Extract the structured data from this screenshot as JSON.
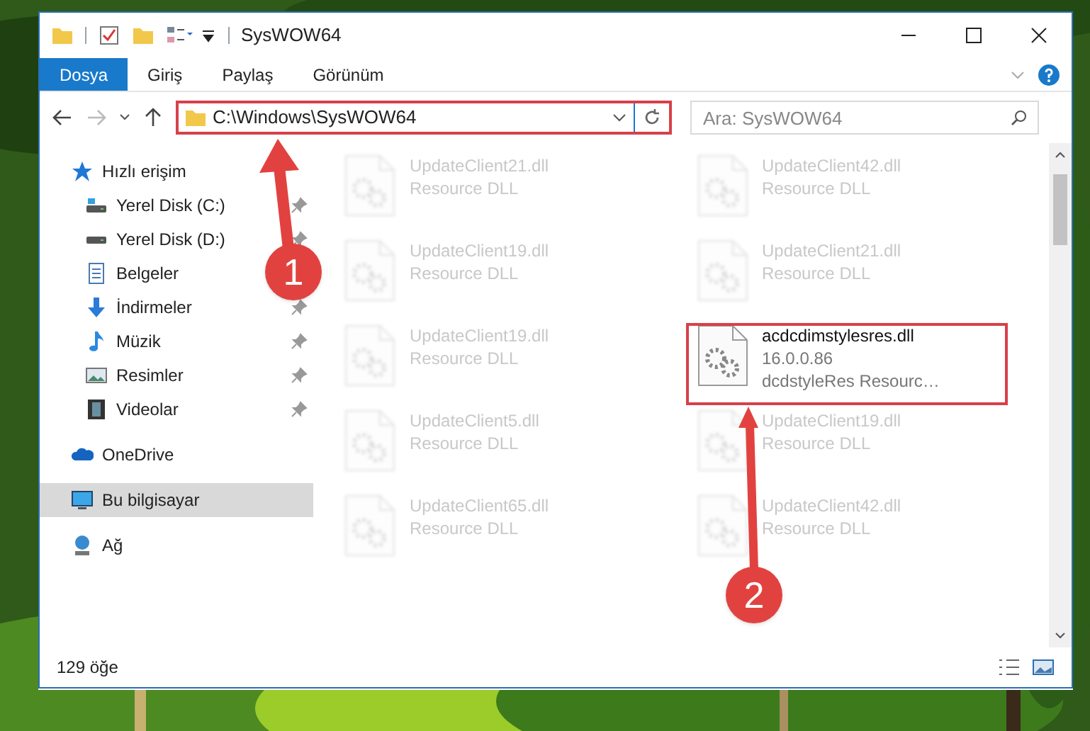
{
  "window": {
    "title": "SysWOW64"
  },
  "ribbon_tabs": [
    {
      "label": "Dosya",
      "kind": "file"
    },
    {
      "label": "Giriş",
      "kind": "tab"
    },
    {
      "label": "Paylaş",
      "kind": "tab"
    },
    {
      "label": "Görünüm",
      "kind": "tab"
    }
  ],
  "address": {
    "value": "C:\\Windows\\SysWOW64"
  },
  "search": {
    "placeholder": "Ara: SysWOW64"
  },
  "sidebar": {
    "items": [
      {
        "label": "Hızlı erişim",
        "kind": "star",
        "selected": false,
        "children": [
          {
            "label": "Yerel Disk (C:)",
            "kind": "drive-c",
            "pinned": true
          },
          {
            "label": "Yerel Disk (D:)",
            "kind": "drive",
            "pinned": true
          },
          {
            "label": "Belgeler",
            "kind": "docs",
            "pinned": false
          },
          {
            "label": "İndirmeler",
            "kind": "download",
            "pinned": true
          },
          {
            "label": "Müzik",
            "kind": "music",
            "pinned": true
          },
          {
            "label": "Resimler",
            "kind": "pictures",
            "pinned": true
          },
          {
            "label": "Videolar",
            "kind": "video",
            "pinned": true
          }
        ]
      },
      {
        "label": "OneDrive",
        "kind": "cloud",
        "selected": false
      },
      {
        "label": "Bu bilgisayar",
        "kind": "pc",
        "selected": true
      },
      {
        "label": "Ağ",
        "kind": "network",
        "selected": false
      }
    ]
  },
  "files": [
    {
      "name": "UpdateClient21.dll",
      "lines": [
        "Resource DLL"
      ],
      "dimmed": true
    },
    {
      "name": "UpdateClient42.dll",
      "lines": [
        "Resource DLL"
      ],
      "dimmed": true
    },
    {
      "name": "UpdateClient19.dll",
      "lines": [
        "Resource DLL"
      ],
      "dimmed": true
    },
    {
      "name": "UpdateClient21.dll",
      "lines": [
        "Resource DLL"
      ],
      "dimmed": true
    },
    {
      "name": "UpdateClient19.dll",
      "lines": [
        "Resource DLL"
      ],
      "dimmed": true
    },
    {
      "name": "acdcdimstylesres.dll",
      "lines": [
        "16.0.0.86",
        "dcdstyleRes Resourc…"
      ],
      "dimmed": false
    },
    {
      "name": "UpdateClient5.dll",
      "lines": [
        "Resource DLL"
      ],
      "dimmed": true
    },
    {
      "name": "UpdateClient19.dll",
      "lines": [
        "Resource DLL"
      ],
      "dimmed": true
    },
    {
      "name": "UpdateClient65.dll",
      "lines": [
        "Resource DLL"
      ],
      "dimmed": true
    },
    {
      "name": "UpdateClient42.dll",
      "lines": [
        "Resource DLL"
      ],
      "dimmed": true
    }
  ],
  "status_bar": {
    "count": "129 öğe"
  },
  "annotations": [
    {
      "label": "1"
    },
    {
      "label": "2"
    }
  ]
}
